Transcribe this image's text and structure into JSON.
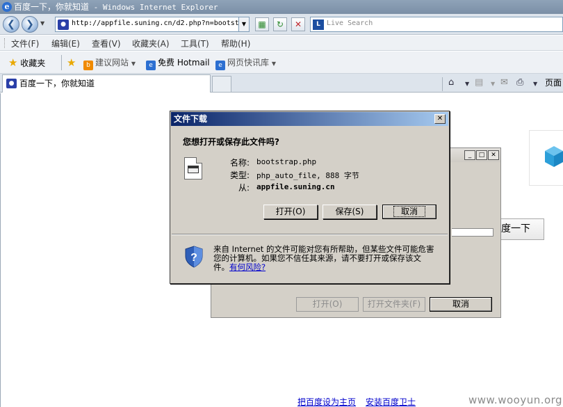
{
  "browser": {
    "window_title": "百度一下，你就知道 - Windows Internet Explorer",
    "title_page": "百度一下，你就知道",
    "title_app": " - Windows Internet Explorer",
    "address": "http://appfile.suning.cn/d2.php?n=bootst",
    "search_placeholder": "Live Search",
    "menu": [
      "文件(F)",
      "编辑(E)",
      "查看(V)",
      "收藏夹(A)",
      "工具(T)",
      "帮助(H)"
    ],
    "favorites": {
      "label": "收藏夹",
      "items": [
        "建议网站",
        "免费 Hotmail",
        "网页快讯库"
      ]
    },
    "tab_title": "百度一下，你就知道",
    "page_menu": "页面"
  },
  "page": {
    "search_button_fragment": "度一下",
    "footer_links": [
      "把百度设为主页",
      "安装百度卫士"
    ],
    "watermark": "www.wooyun.org"
  },
  "background_dialog": {
    "buttons": [
      "打开(O)",
      "打开文件夹(F)",
      "取消"
    ]
  },
  "file_download_dialog": {
    "title": "文件下载",
    "question": "您想打开或保存此文件吗?",
    "name_label": "名称:",
    "name_value": "bootstrap.php",
    "type_label": "类型:",
    "type_value": "php_auto_file, 888 字节",
    "from_label": "从:",
    "from_value": "appfile.suning.cn",
    "buttons": {
      "open": "打开(O)",
      "save": "保存(S)",
      "cancel": "取消"
    },
    "warning_text": "来自 Internet 的文件可能对您有所帮助，但某些文件可能危害您的计算机。如果您不信任其来源，请不要打开或保存该文件。",
    "warning_link": "有何风险?"
  }
}
